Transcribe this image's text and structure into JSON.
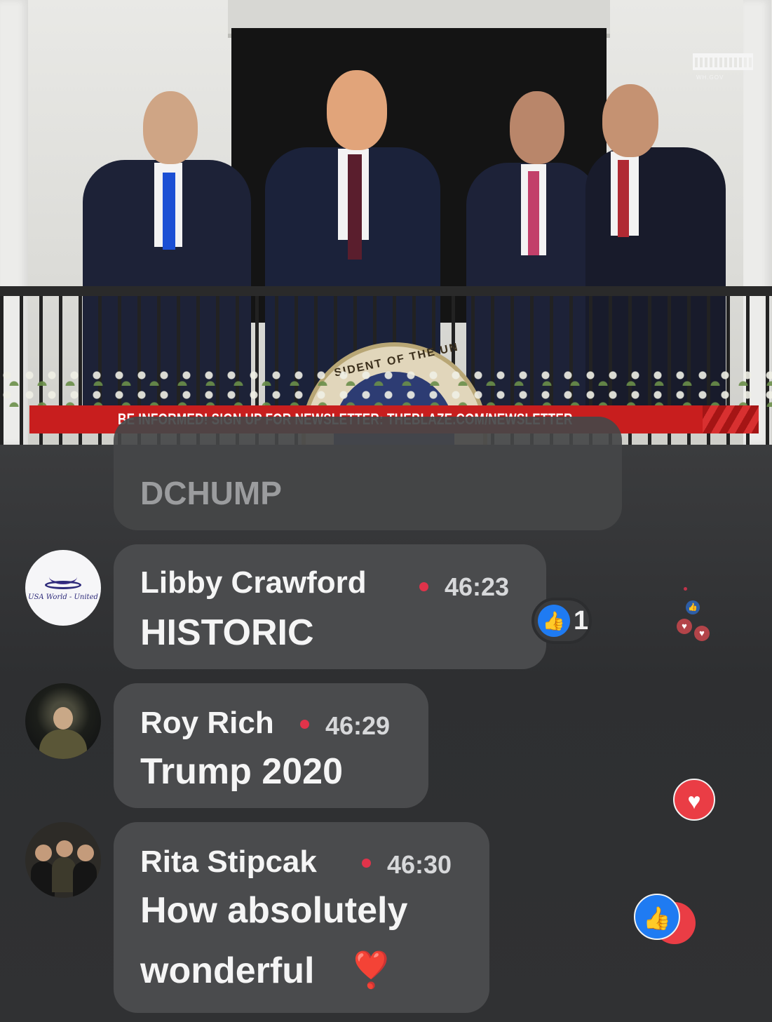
{
  "video": {
    "banner_text": "BE INFORMED! SIGN UP FOR NEWSLETTER: THEBLAZE.COM/NEWSLETTER",
    "seal_text": "SIDENT OF THE UN",
    "watermark_caption": "WH.GOV"
  },
  "comments": {
    "previous": {
      "text": "DCHUMP"
    },
    "items": [
      {
        "name": "Libby Crawford",
        "time": "46:23",
        "text": "HISTORIC",
        "avatar": "usa-world-united-logo",
        "reaction_count": "1",
        "avatar_text": "USA World - United"
      },
      {
        "name": "Roy Rich",
        "time": "46:29",
        "text": "Trump 2020",
        "avatar": "profile-photo"
      },
      {
        "name": "Rita Stipcak",
        "time": "46:30",
        "text_line1": "How absolutely",
        "text_line2": "wonderful",
        "emoji": "❣️",
        "avatar": "profile-photo"
      }
    ]
  },
  "colors": {
    "banner_red": "#c81e1e",
    "like_blue": "#1f7bf2",
    "heart_red": "#ea3d45",
    "dot_red": "#e0334a"
  },
  "icons": {
    "like": "thumbs-up-icon",
    "heart": "heart-icon"
  }
}
